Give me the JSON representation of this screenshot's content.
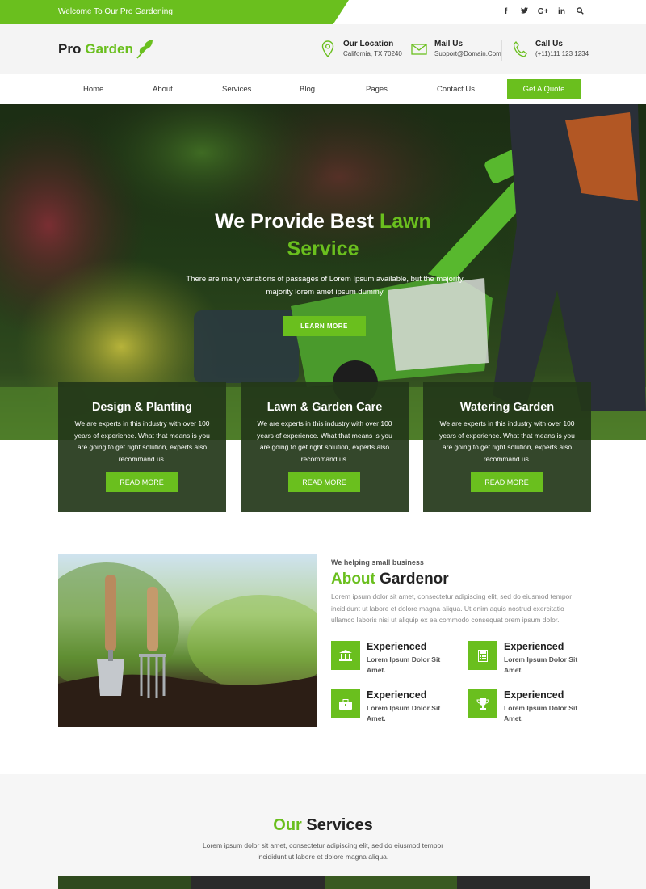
{
  "topbar": {
    "welcome": "Welcome To Our Pro Gardening",
    "social": [
      "f",
      "t",
      "G+",
      "in"
    ]
  },
  "header": {
    "logo_pro": "Pro",
    "logo_garden": "Garden",
    "location": {
      "title": "Our Location",
      "value": "California, TX 70240"
    },
    "mail": {
      "title": "Mail Us",
      "value": "Support@Domain.Com"
    },
    "call": {
      "title": "Call Us",
      "value": "(+11)111 123 1234"
    }
  },
  "nav": {
    "items": [
      "Home",
      "About",
      "Services",
      "Blog",
      "Pages",
      "Contact Us"
    ],
    "quote": "Get A Quote"
  },
  "hero": {
    "title_white": "We Provide Best",
    "title_green_1": "Lawn",
    "title_green_2": "Service",
    "subtitle": "There are many variations of passages of Lorem Ipsum available, but the majority majority lorem amet ipsum dummy",
    "button": "LEARN MORE"
  },
  "cards": [
    {
      "title": "Design & Planting",
      "text": "We are experts in this industry with over 100 years of experience. What that means is you are going to get right solution, experts also recommand us.",
      "button": "READ MORE"
    },
    {
      "title": "Lawn & Garden Care",
      "text": "We are experts in this industry with over 100 years of experience. What that means is you are going to get right solution, experts also recommand us.",
      "button": "READ MORE"
    },
    {
      "title": "Watering Garden",
      "text": "We are experts in this industry with over 100 years of experience. What that means is you are going to get right solution, experts also recommand us.",
      "button": "READ MORE"
    }
  ],
  "about": {
    "small": "We helping small business",
    "title_green": "About",
    "title_dark": "Gardenor",
    "text": "Lorem ipsum dolor sit amet, consectetur adipiscing elit, sed do eiusmod tempor incididunt ut labore et dolore magna aliqua. Ut enim aquis nostrud exercitatio ullamco laboris nisi ut aliquip ex ea commodo consequat orem ipsum dolor.",
    "features": [
      {
        "title": "Experienced",
        "text": "Lorem Ipsum Dolor Sit Amet.",
        "icon": "bank-icon"
      },
      {
        "title": "Experienced",
        "text": "Lorem Ipsum Dolor Sit Amet.",
        "icon": "calculator-icon"
      },
      {
        "title": "Experienced",
        "text": "Lorem Ipsum Dolor Sit Amet.",
        "icon": "briefcase-icon"
      },
      {
        "title": "Experienced",
        "text": "Lorem Ipsum Dolor Sit Amet.",
        "icon": "trophy-icon"
      }
    ]
  },
  "services": {
    "title_green": "Our",
    "title_dark": "Services",
    "text": "Lorem ipsum dolor sit amet, consectetur adipiscing elit, sed do eiusmod tempor incididunt ut labore et dolore magna aliqua."
  },
  "colors": {
    "accent": "#6abf1e",
    "dark": "#222222"
  }
}
